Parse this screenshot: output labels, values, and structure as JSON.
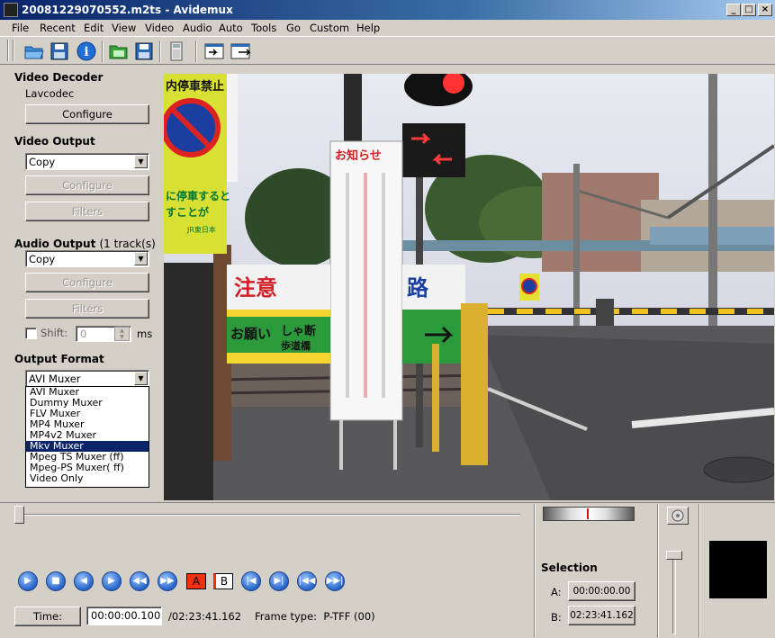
{
  "window": {
    "title": "20081229070552.m2ts - Avidemux"
  },
  "menu": [
    "File",
    "Recent",
    "Edit",
    "View",
    "Video",
    "Audio",
    "Auto",
    "Tools",
    "Go",
    "Custom",
    "Help"
  ],
  "video_decoder": {
    "header": "Video Decoder",
    "codec": "Lavcodec",
    "configure": "Configure"
  },
  "video_output": {
    "header": "Video Output",
    "selected": "Copy",
    "configure": "Configure",
    "filters": "Filters"
  },
  "audio_output": {
    "header": "Audio Output",
    "tracks": "(1 track(s))",
    "selected": "Copy",
    "configure": "Configure",
    "filters": "Filters",
    "shift_label": "Shift:",
    "shift_value": "0",
    "shift_unit": "ms"
  },
  "output_format": {
    "header": "Output Format",
    "selected": "AVI Muxer",
    "options": [
      "AVI Muxer",
      "Dummy Muxer",
      "FLV Muxer",
      "MP4 Muxer",
      "MP4v2 Muxer",
      "Mkv Muxer",
      "Mpeg TS Muxer (ff)",
      "Mpeg-PS Muxer( ff)",
      "Video Only"
    ],
    "highlighted_index": 5
  },
  "video_signs": {
    "top_left": "内停車禁止",
    "notice_title": "お知らせ",
    "caution_left": "注意",
    "caution_right": "路",
    "please": "お願い",
    "walkway": "しゃ断",
    "walkway2": "歩道橋",
    "stop_text1": "に停車すると",
    "stop_text2": "すことが",
    "jr": "JR東日本"
  },
  "bottom": {
    "time_button": "Time:",
    "current_time": "00:00:00.100",
    "total_time": "/02:23:41.162",
    "frame_type": "Frame type:  P-TFF (00)",
    "marker_a": "A",
    "marker_b": "B",
    "selection": {
      "header": "Selection",
      "a_label": "A:",
      "a_value": "00:00:00.00",
      "b_label": "B:",
      "b_value": "02:23:41.162"
    }
  },
  "colors": {
    "titlebar": "#0a246a",
    "highlight": "#0a246a",
    "play_button": "#2463c9"
  }
}
